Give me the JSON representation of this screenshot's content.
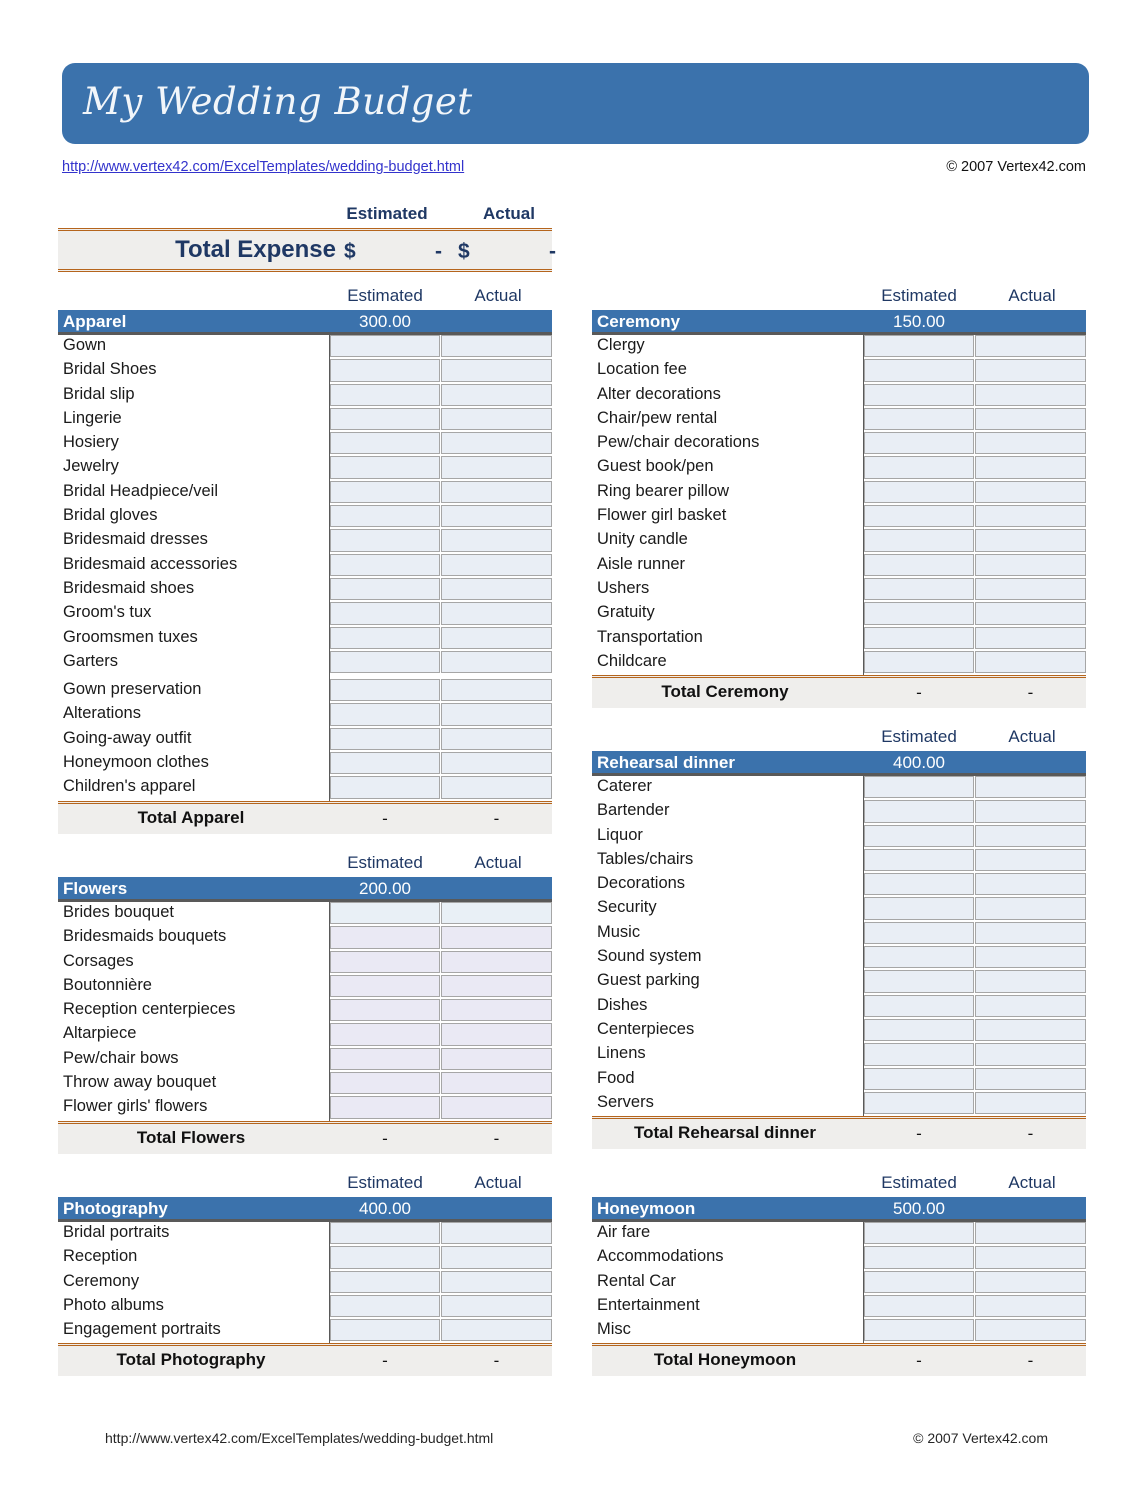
{
  "document": {
    "title": "My Wedding Budget",
    "header_link": "http://www.vertex42.com/ExcelTemplates/wedding-budget.html",
    "header_copyright": "© 2007 Vertex42.com",
    "footer_link": "http://www.vertex42.com/ExcelTemplates/wedding-budget.html",
    "footer_copyright": "© 2007 Vertex42.com"
  },
  "columns": {
    "estimated": "Estimated",
    "actual": "Actual"
  },
  "grand_total": {
    "label": "Total Expense",
    "currency": "$",
    "estimated": "-",
    "actual": "-"
  },
  "sections": [
    {
      "name": "Apparel",
      "budget": "300.00",
      "total_label": "Total Apparel",
      "total_estimated": "-",
      "total_actual": "-",
      "items": [
        "Gown",
        "Bridal Shoes",
        "Bridal slip",
        "Lingerie",
        "Hosiery",
        "Jewelry",
        "Bridal Headpiece/veil",
        "Bridal gloves",
        "Bridesmaid dresses",
        "Bridesmaid accessories",
        "Bridesmaid shoes",
        "Groom's tux",
        "Groomsmen tuxes",
        "Garters",
        "Gown preservation",
        "Alterations",
        "Going-away outfit",
        "Honeymoon clothes",
        "Children's apparel"
      ]
    },
    {
      "name": "Ceremony",
      "budget": "150.00",
      "total_label": "Total Ceremony",
      "total_estimated": "-",
      "total_actual": "-",
      "items": [
        "Clergy",
        "Location fee",
        "Alter decorations",
        "Chair/pew rental",
        "Pew/chair decorations",
        "Guest book/pen",
        "Ring bearer pillow",
        "Flower girl basket",
        "Unity candle",
        "Aisle runner",
        "Ushers",
        "Gratuity",
        "Transportation",
        "Childcare"
      ]
    },
    {
      "name": "Flowers",
      "budget": "200.00",
      "total_label": "Total Flowers",
      "total_estimated": "-",
      "total_actual": "-",
      "items": [
        "Brides bouquet",
        "Bridesmaids bouquets",
        "Corsages",
        "Boutonnière",
        "Reception centerpieces",
        "Altarpiece",
        "Pew/chair bows",
        "Throw away bouquet",
        "Flower girls' flowers"
      ]
    },
    {
      "name": "Rehearsal dinner",
      "budget": "400.00",
      "total_label": "Total Rehearsal dinner",
      "total_estimated": "-",
      "total_actual": "-",
      "items": [
        "Caterer",
        "Bartender",
        "Liquor",
        "Tables/chairs",
        "Decorations",
        "Security",
        "Music",
        "Sound system",
        "Guest parking",
        "Dishes",
        "Centerpieces",
        "Linens",
        "Food",
        "Servers"
      ]
    },
    {
      "name": "Photography",
      "budget": "400.00",
      "total_label": "Total Photography",
      "total_estimated": "-",
      "total_actual": "-",
      "items": [
        "Bridal portraits",
        "Reception",
        "Ceremony",
        "Photo albums",
        "Engagement portraits"
      ]
    },
    {
      "name": "Honeymoon",
      "budget": "500.00",
      "total_label": "Total Honeymoon",
      "total_estimated": "-",
      "total_actual": "-",
      "items": [
        "Air fare",
        "Accommodations",
        "Rental Car",
        "Entertainment",
        "Misc"
      ]
    }
  ],
  "cell_values": {
    "empty": ""
  },
  "colors": {
    "header_blue": "#3b72ac",
    "total_band": "#efeeec",
    "rule_orange": "#b5651d",
    "input_cell": "#e9eef5",
    "input_cell_alt": "#eae9f4",
    "heading_navy": "#1f3864",
    "link_blue": "#3333cc"
  }
}
